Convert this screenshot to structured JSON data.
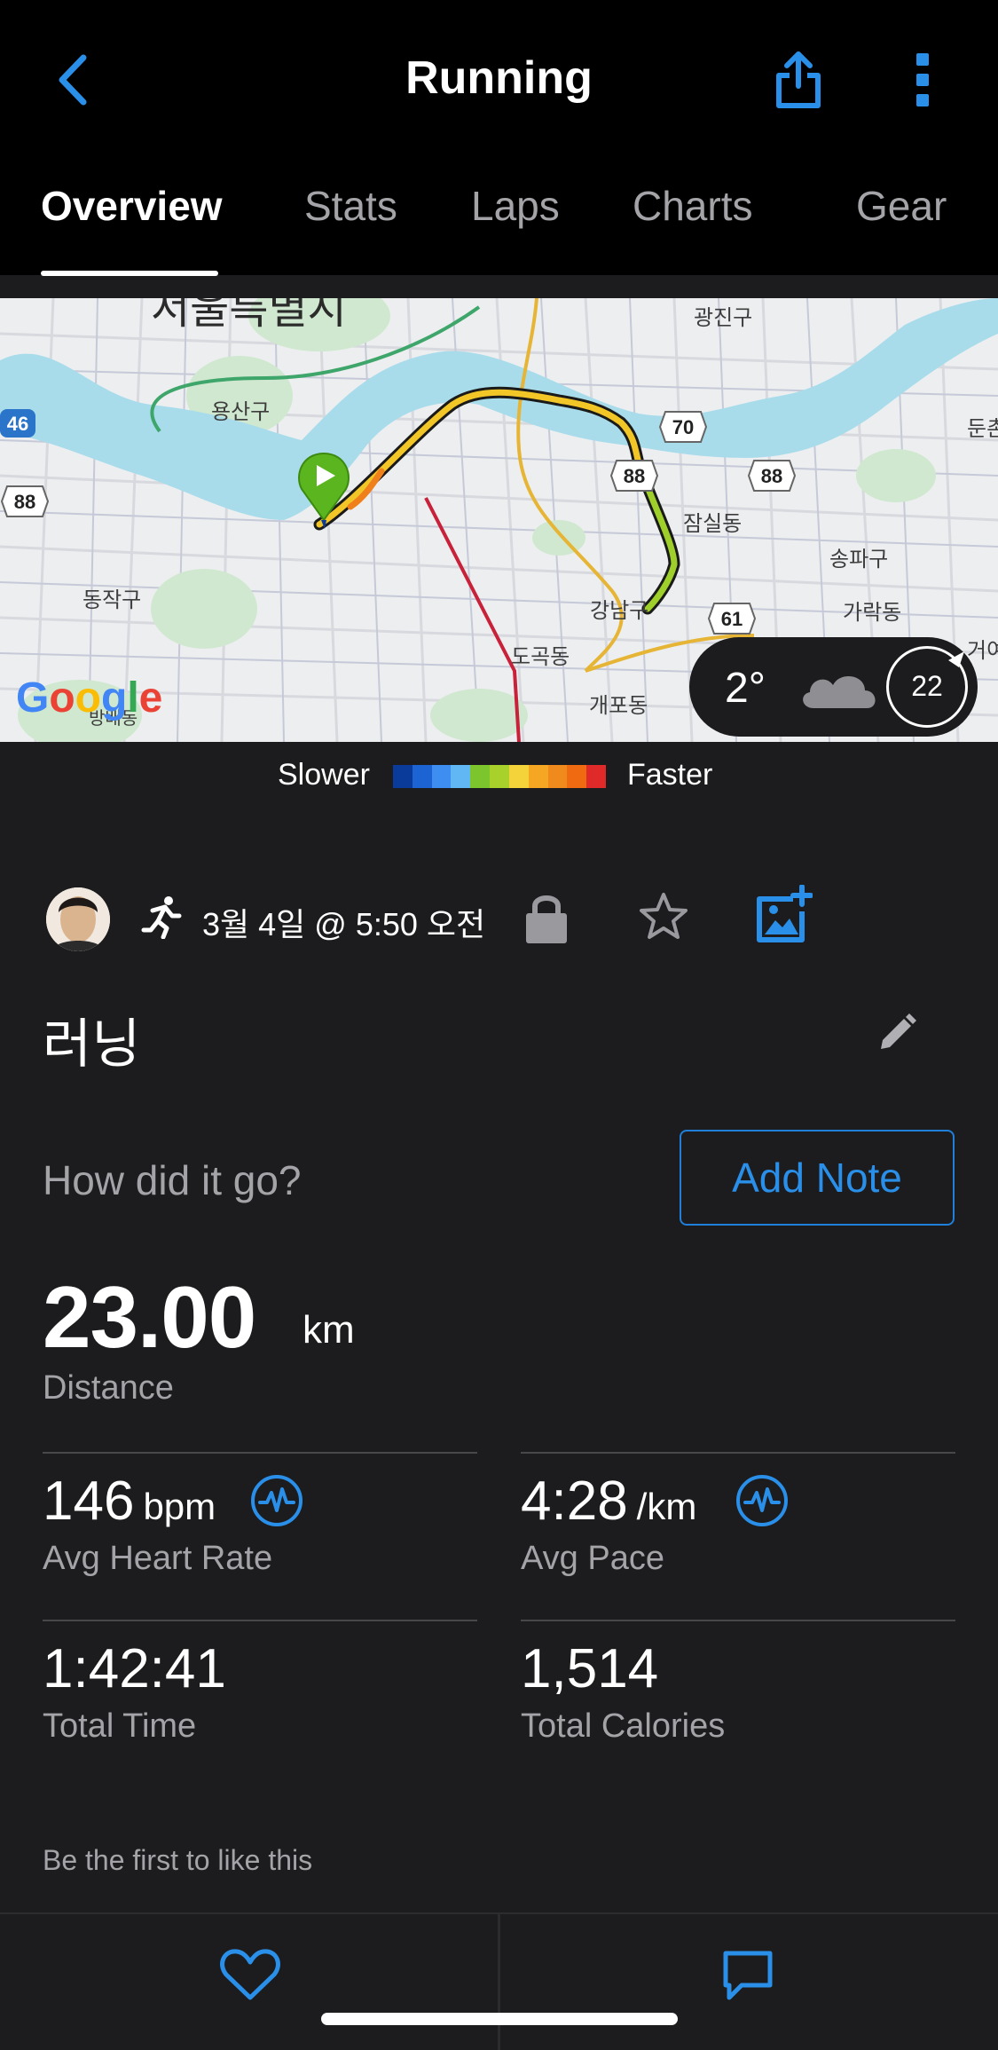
{
  "header": {
    "title": "Running"
  },
  "tabs": [
    {
      "label": "Overview",
      "active": true
    },
    {
      "label": "Stats",
      "active": false
    },
    {
      "label": "Laps",
      "active": false
    },
    {
      "label": "Charts",
      "active": false
    },
    {
      "label": "Gear",
      "active": false
    }
  ],
  "map": {
    "labels": {
      "seoul": "서울특별시",
      "gwangjin": "광진구",
      "yongsan": "용산구",
      "jamsil": "잠실동",
      "songpa": "송파구",
      "dongjak": "동작구",
      "gangnam": "강남구",
      "dogok": "도곡동",
      "garak": "가락동",
      "gaepo": "개포동",
      "dun": "둔촌",
      "geoeo": "거여",
      "bangbae": "방배동"
    },
    "road_badges": [
      "46",
      "88",
      "70",
      "88",
      "88",
      "61"
    ],
    "google_logo": "Google",
    "weather": {
      "temperature": "2°",
      "wind": "22"
    }
  },
  "pace_legend": {
    "slower": "Slower",
    "faster": "Faster",
    "colors": [
      "#0a3a9a",
      "#1c63d4",
      "#3d8ef0",
      "#61b7f4",
      "#7cc52c",
      "#a9d12c",
      "#f4d33a",
      "#f5a623",
      "#f08a1c",
      "#ef6a10",
      "#e02a2a"
    ]
  },
  "activity": {
    "date": "3월 4일 @ 5:50 오전",
    "name": "러닝",
    "prompt": "How did it go?",
    "add_note_label": "Add Note"
  },
  "stats": {
    "distance": {
      "value": "23.00",
      "unit": "km",
      "label": "Distance"
    },
    "avg_heart_rate": {
      "value": "146",
      "unit": "bpm",
      "label": "Avg Heart Rate"
    },
    "avg_pace": {
      "value": "4:28",
      "unit": "/km",
      "label": "Avg Pace"
    },
    "total_time": {
      "value": "1:42:41",
      "label": "Total Time"
    },
    "total_calories": {
      "value": "1,514",
      "label": "Total Calories"
    }
  },
  "social": {
    "likes_text": "Be the first to like this"
  },
  "colors": {
    "accent_blue": "#2a8fe8",
    "background": "#1c1c1e",
    "topbar": "#000000",
    "muted_text": "#a4a4a8",
    "start_marker": "#5bb51e"
  }
}
